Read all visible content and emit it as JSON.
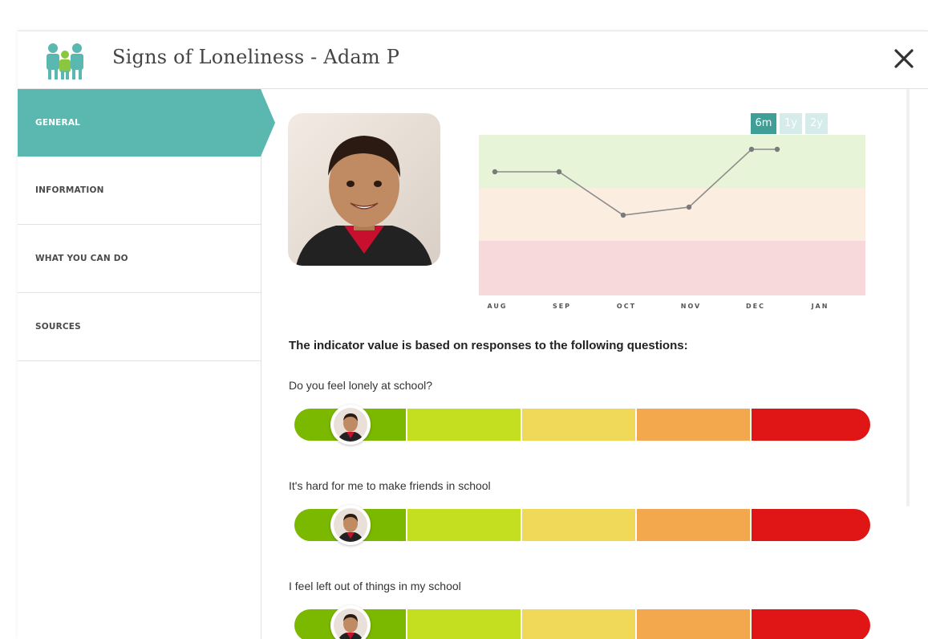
{
  "header": {
    "title": "Signs of Loneliness  -  Adam P",
    "logo_icon": "family-group-icon",
    "close_icon": "close-icon"
  },
  "sidebar": {
    "items": [
      {
        "label": "GENERAL",
        "active": true
      },
      {
        "label": "INFORMATION",
        "active": false
      },
      {
        "label": "WHAT YOU CAN DO",
        "active": false
      },
      {
        "label": "SOURCES",
        "active": false
      }
    ]
  },
  "chart": {
    "range_buttons": [
      {
        "label": "6m",
        "selected": true
      },
      {
        "label": "1y",
        "selected": false
      },
      {
        "label": "2y",
        "selected": false
      }
    ]
  },
  "chart_data": {
    "type": "line",
    "categories": [
      "AUG",
      "SEP",
      "OCT",
      "NOV",
      "DEC",
      "JAN"
    ],
    "series": [
      {
        "values": [
          0.77,
          0.77,
          0.5,
          0.55,
          0.91,
          0.91
        ]
      }
    ],
    "ylim": [
      0,
      1
    ],
    "bands": [
      {
        "from": 0.0,
        "to": 0.34,
        "color": "#f7d9dc"
      },
      {
        "from": 0.34,
        "to": 0.67,
        "color": "#fbeee0"
      },
      {
        "from": 0.67,
        "to": 1.0,
        "color": "#e8f4d8"
      }
    ],
    "grid": false,
    "line_color": "#8c8c8c",
    "point_color": "#7a7a7a"
  },
  "questions": {
    "heading": "The indicator value is based on responses to the following questions:",
    "scale_colors": [
      "#7bb800",
      "#c3df1f",
      "#f0d858",
      "#f4a84e",
      "#e01515"
    ],
    "items": [
      {
        "text": "Do you feel lonely at school?",
        "level": 1
      },
      {
        "text": "It's hard for me to make friends in school",
        "level": 1
      },
      {
        "text": "I feel left out of things in my school",
        "level": 1
      }
    ]
  },
  "colors": {
    "accent": "#5bb8b0",
    "accent_dark": "#3f9e96"
  }
}
